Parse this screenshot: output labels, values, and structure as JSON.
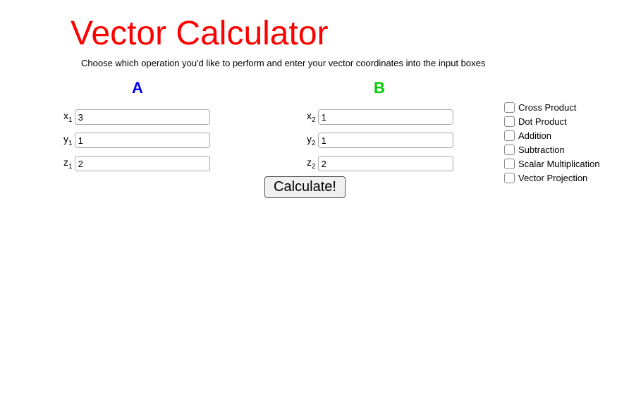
{
  "title": "Vector Calculator",
  "subtitle": "Choose which operation you'd like to perform and enter your vector coordinates into the input boxes",
  "vectorA": {
    "header": "A",
    "x": {
      "label_base": "x",
      "label_sub": "1",
      "value": "3"
    },
    "y": {
      "label_base": "y",
      "label_sub": "1",
      "value": "1"
    },
    "z": {
      "label_base": "z",
      "label_sub": "1",
      "value": "2"
    }
  },
  "vectorB": {
    "header": "B",
    "x": {
      "label_base": "x",
      "label_sub": "2",
      "value": "1"
    },
    "y": {
      "label_base": "y",
      "label_sub": "2",
      "value": "1"
    },
    "z": {
      "label_base": "z",
      "label_sub": "2",
      "value": "2"
    }
  },
  "calculate_label": "Calculate!",
  "operations": [
    {
      "label": "Cross Product"
    },
    {
      "label": "Dot Product"
    },
    {
      "label": "Addition"
    },
    {
      "label": "Subtraction"
    },
    {
      "label": "Scalar Multiplication"
    },
    {
      "label": "Vector Projection"
    }
  ]
}
